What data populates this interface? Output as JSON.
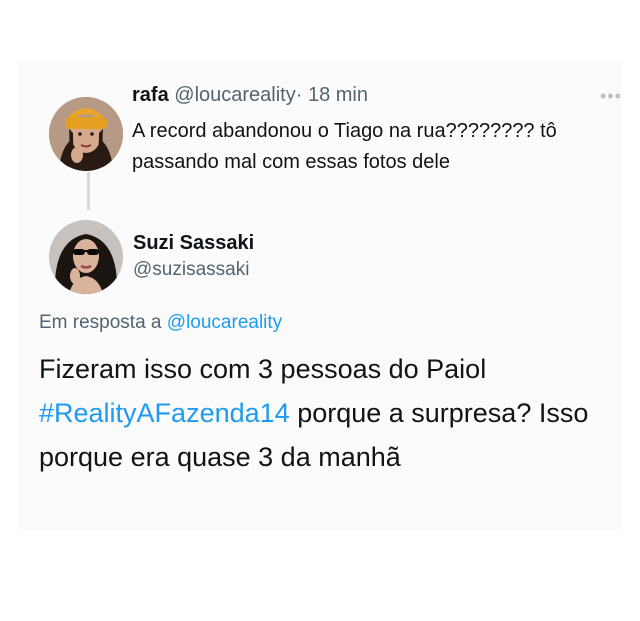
{
  "parent_tweet": {
    "display_name": "rafa",
    "handle": "@loucareality",
    "separator": "·",
    "time": "18 min",
    "text": "A record abandonou o Tiago na rua???????? tô passando mal com essas fotos dele",
    "more_icon": "more-horizontal-icon"
  },
  "reply_tweet": {
    "display_name": "Suzi Sassaki",
    "handle": "@suzisassaki",
    "reply_prefix": "Em resposta a",
    "reply_to": "@loucareality",
    "text_before_hashtag": "Fizeram isso com 3 pessoas do Paiol",
    "hashtag": "#RealityAFazenda14",
    "text_after_hashtag": "porque a surpresa? Isso porque era quase 3 da manhã"
  },
  "colors": {
    "link": "#1d9bf0",
    "muted": "#536471",
    "text": "#0f1419"
  }
}
